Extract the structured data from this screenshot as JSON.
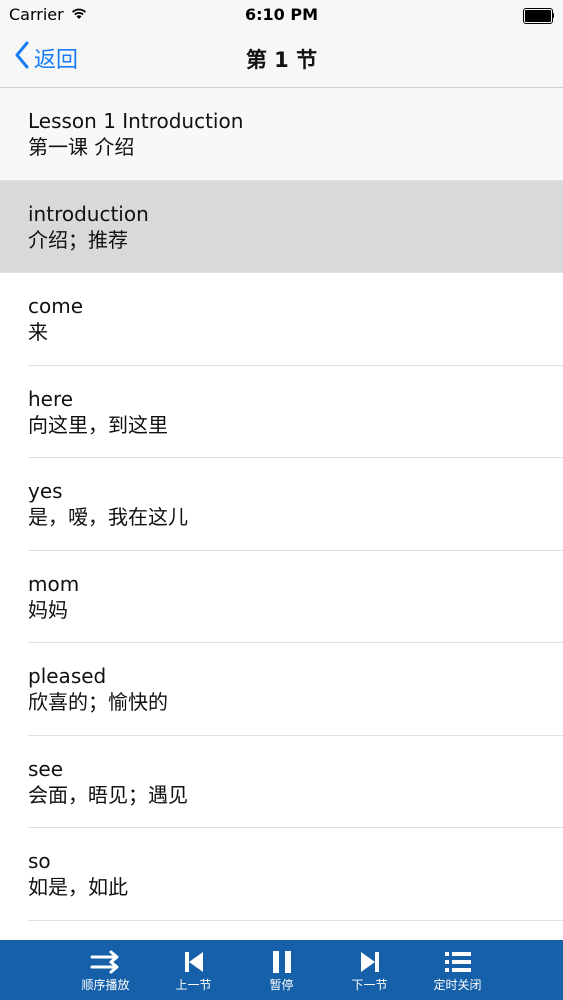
{
  "status_bar": {
    "carrier": "Carrier",
    "time": "6:10 PM"
  },
  "nav": {
    "back_label": "返回",
    "title": "第 1 节"
  },
  "colors": {
    "accent": "#1a7cf5",
    "toolbar": "#1560a8",
    "selected_row": "#d9d9dc"
  },
  "list": {
    "items": [
      {
        "en": "Lesson 1 Introduction",
        "zh": "第一课 介绍"
      },
      {
        "en": "introduction",
        "zh": "介绍；推荐"
      },
      {
        "en": "come",
        "zh": "来"
      },
      {
        "en": "here",
        "zh": "向这里，到这里"
      },
      {
        "en": "yes",
        "zh": "是，嗳，我在这儿"
      },
      {
        "en": "mom",
        "zh": "妈妈"
      },
      {
        "en": "pleased",
        "zh": "欣喜的；愉快的"
      },
      {
        "en": "see",
        "zh": "会面，晤见；遇见"
      },
      {
        "en": "so",
        "zh": "如是，如此"
      }
    ]
  },
  "toolbar": {
    "items": [
      {
        "label": "顺序播放",
        "icon": "sequence-play-icon"
      },
      {
        "label": "上一节",
        "icon": "previous-icon"
      },
      {
        "label": "暂停",
        "icon": "pause-icon"
      },
      {
        "label": "下一节",
        "icon": "next-icon"
      },
      {
        "label": "定时关闭",
        "icon": "timer-list-icon"
      }
    ]
  }
}
